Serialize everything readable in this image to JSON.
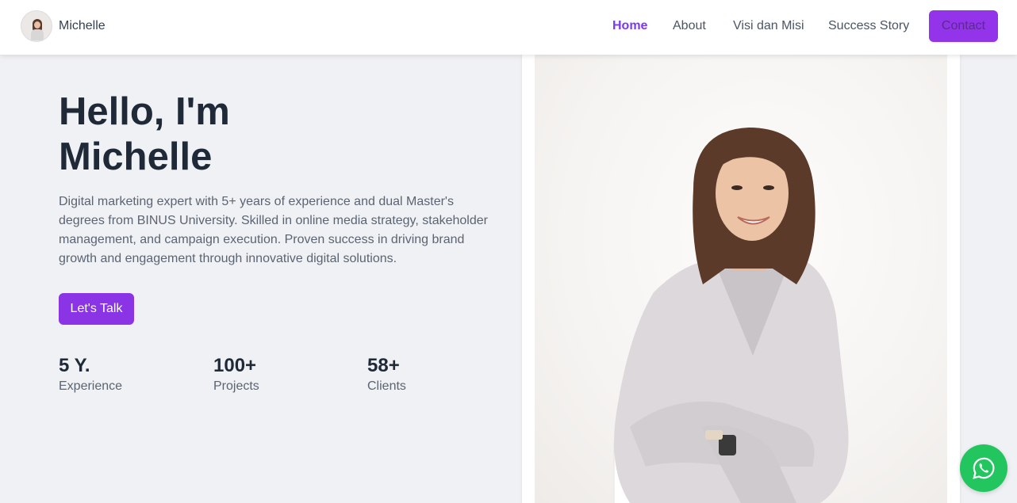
{
  "header": {
    "brand_name": "Michelle",
    "nav": {
      "home": "Home",
      "about": "About",
      "visi_misi": "Visi dan Misi",
      "success_story": "Success Story",
      "contact": "Contact"
    }
  },
  "hero": {
    "title_line1": "Hello, I'm",
    "title_line2": "Michelle",
    "description": "Digital marketing expert with 5+ years of experience and dual Master's degrees from BINUS University. Skilled in online media strategy, stakeholder management, and campaign execution. Proven success in driving brand growth and engagement through innovative digital solutions.",
    "cta_label": "Let's Talk",
    "stats": [
      {
        "value": "5 Y.",
        "label": "Experience"
      },
      {
        "value": "100+",
        "label": "Projects"
      },
      {
        "value": "58+",
        "label": "Clients"
      }
    ]
  },
  "colors": {
    "accent": "#7c3aed",
    "button": "#9333ea",
    "whatsapp": "#22c55e",
    "background": "#f0f1f4"
  },
  "icons": {
    "whatsapp": "whatsapp-icon"
  }
}
